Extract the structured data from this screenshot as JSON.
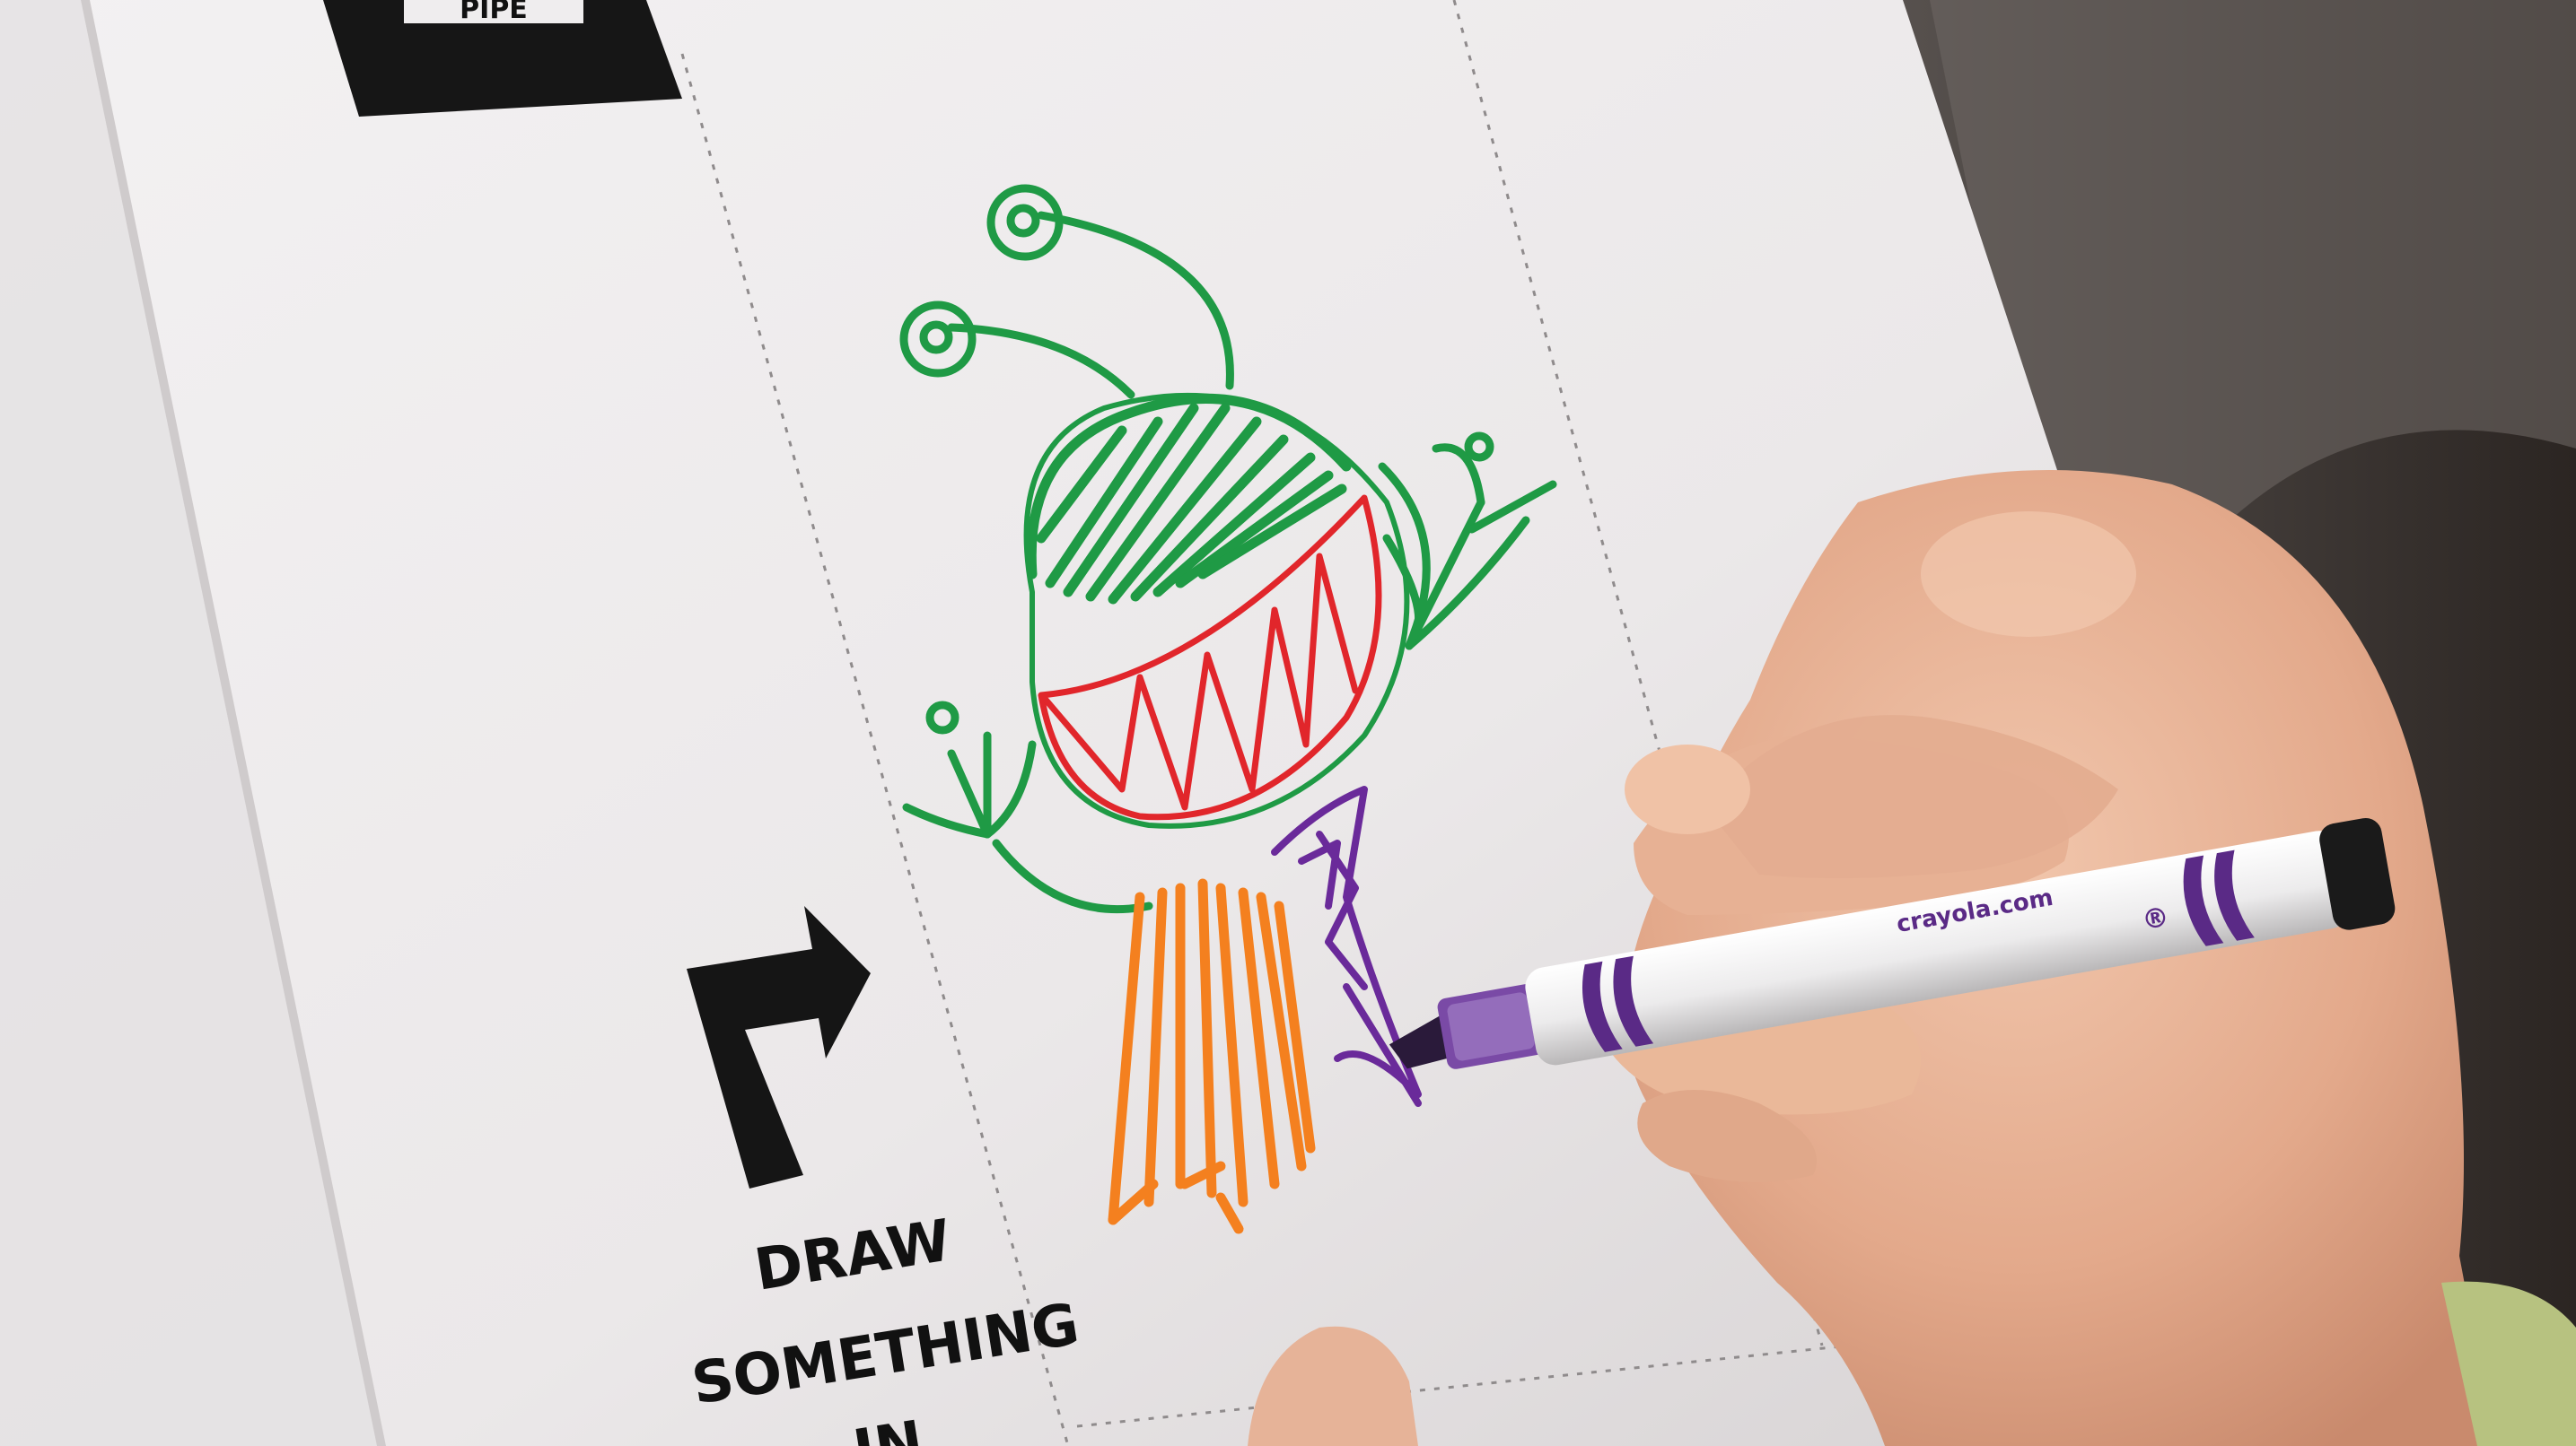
{
  "photo": {
    "subject": "hand coloring a drawing with a marker",
    "colors": {
      "paper": "#efedee",
      "paper_shadow": "#dcd9da",
      "print_black": "#151515",
      "drawing_green": "#1f9a45",
      "drawing_red": "#e1262b",
      "drawing_orange": "#f4801f",
      "drawing_purple": "#6a2a9a",
      "marker_body": "#f4f2f3",
      "marker_tip": "#5a2a86",
      "skin": "#e9b69a"
    }
  },
  "sheet": {
    "top_label": "PIPE",
    "instruction_lines": [
      "DRAW",
      "SOMETHING",
      "IN"
    ],
    "arrow_icon": "turn-right-arrow-icon"
  },
  "marker": {
    "brand_text": "crayola.com",
    "registered_mark": "®"
  }
}
